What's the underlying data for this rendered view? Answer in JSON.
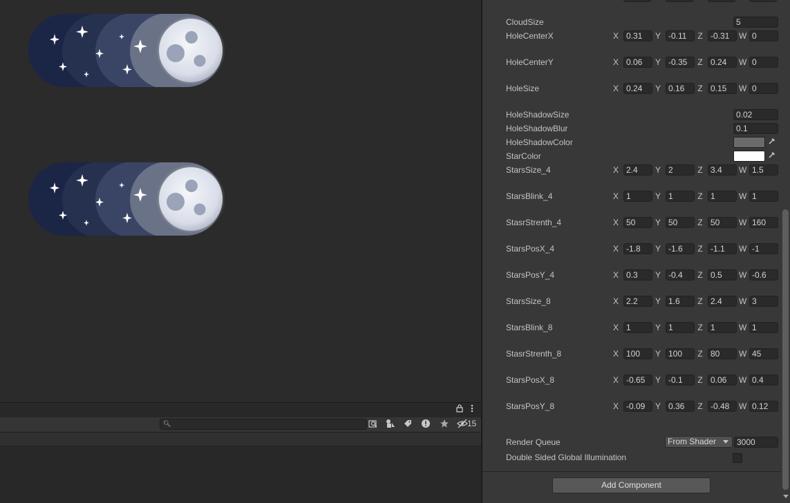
{
  "scene": {
    "toggles": [
      {
        "name": "night-toggle-1"
      },
      {
        "name": "night-toggle-2"
      }
    ]
  },
  "project": {
    "hidden_count": "15",
    "icons": [
      "lock-icon",
      "kebab-menu-icon",
      "search-icon",
      "scene-search-icon",
      "filter-type-icon",
      "label-icon",
      "error-icon",
      "star-icon",
      "hidden-icon"
    ]
  },
  "inspector": {
    "cloud_size": {
      "label": "CloudSize",
      "value": "5"
    },
    "vectors": [
      {
        "label": "HoleCenterX",
        "x": "0.31",
        "y": "-0.11",
        "z": "-0.31",
        "w": "0"
      },
      {
        "label": "HoleCenterY",
        "x": "0.06",
        "y": "-0.35",
        "z": "0.24",
        "w": "0"
      },
      {
        "label": "HoleSize",
        "x": "0.24",
        "y": "0.16",
        "z": "0.15",
        "w": "0"
      }
    ],
    "floats": [
      {
        "label": "HoleShadowSize",
        "value": "0.02"
      },
      {
        "label": "HoleShadowBlur",
        "value": "0.1"
      }
    ],
    "colors": [
      {
        "label": "HoleShadowColor",
        "color": "#6b6b6b"
      },
      {
        "label": "StarColor",
        "color": "#ffffff"
      }
    ],
    "star_vectors": [
      {
        "label": "StarsSize_4",
        "x": "2.4",
        "y": "2",
        "z": "3.4",
        "w": "1.5"
      },
      {
        "label": "StarsBlink_4",
        "x": "1",
        "y": "1",
        "z": "1",
        "w": "1"
      },
      {
        "label": "StasrStrenth_4",
        "x": "50",
        "y": "50",
        "z": "50",
        "w": "160"
      },
      {
        "label": "StarsPosX_4",
        "x": "-1.8",
        "y": "-1.6",
        "z": "-1.1",
        "w": "-1"
      },
      {
        "label": "StarsPosY_4",
        "x": "0.3",
        "y": "-0.4",
        "z": "0.5",
        "w": "-0.6"
      },
      {
        "label": "StarsSize_8",
        "x": "2.2",
        "y": "1.6",
        "z": "2.4",
        "w": "3"
      },
      {
        "label": "StarsBlink_8",
        "x": "1",
        "y": "1",
        "z": "1",
        "w": "1"
      },
      {
        "label": "StasrStrenth_8",
        "x": "100",
        "y": "100",
        "z": "80",
        "w": "45"
      },
      {
        "label": "StarsPosX_8",
        "x": "-0.65",
        "y": "-0.1",
        "z": "0.06",
        "w": "0.4"
      },
      {
        "label": "StarsPosY_8",
        "x": "-0.09",
        "y": "0.36",
        "z": "-0.48",
        "w": "0.12"
      }
    ],
    "axis_labels": {
      "x": "X",
      "y": "Y",
      "z": "Z",
      "w": "W"
    },
    "render_queue": {
      "label": "Render Queue",
      "mode": "From Shader",
      "value": "3000"
    },
    "double_sided": {
      "label": "Double Sided Global Illumination",
      "checked": false
    },
    "add_component": "Add Component"
  }
}
